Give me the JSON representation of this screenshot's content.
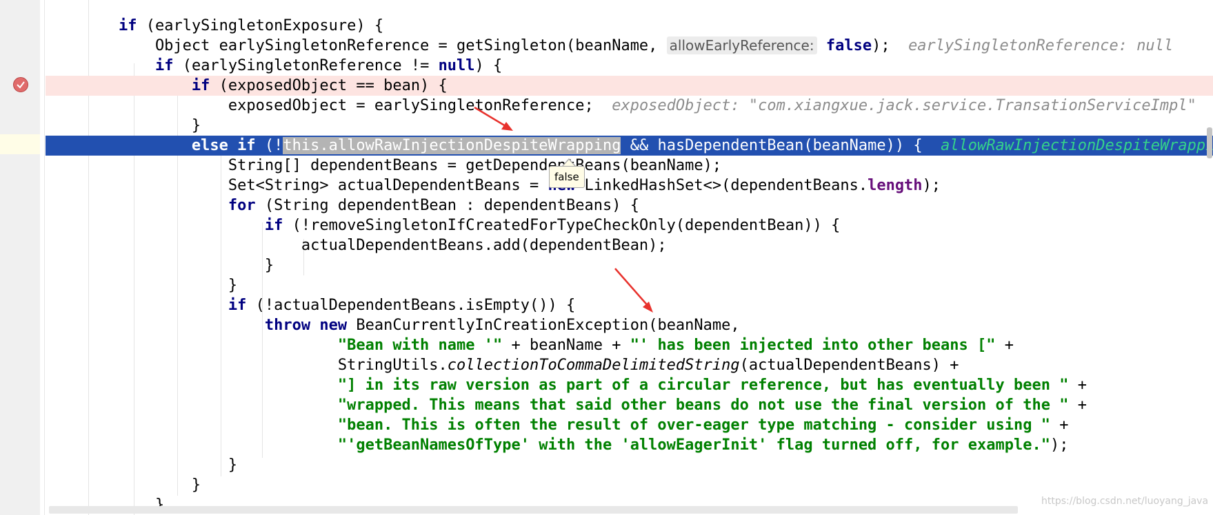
{
  "editor": {
    "lines": [
      [
        {
          "t": "        "
        },
        {
          "t": "if",
          "c": "kw"
        },
        {
          "t": " (earlySingletonExposure) {"
        }
      ],
      [
        {
          "t": "            Object earlySingletonReference = getSingleton(beanName, "
        },
        {
          "t": "allowEarlyReference:",
          "c": "param"
        },
        {
          "t": " "
        },
        {
          "t": "false",
          "c": "kw"
        },
        {
          "t": ");  "
        },
        {
          "t": "earlySingletonReference: null",
          "c": "cmt"
        }
      ],
      [
        {
          "t": "            "
        },
        {
          "t": "if",
          "c": "kw"
        },
        {
          "t": " (earlySingletonReference != "
        },
        {
          "t": "null",
          "c": "kw"
        },
        {
          "t": ") {"
        }
      ],
      [
        {
          "t": "                "
        },
        {
          "t": "if",
          "c": "kw"
        },
        {
          "t": " (exposedObject == bean) {"
        }
      ],
      [
        {
          "t": "                    exposedObject = earlySingletonReference;  "
        },
        {
          "t": "exposedObject: \"com.xiangxue.jack.service.TransationServiceImpl\"",
          "c": "cmt"
        }
      ],
      [
        {
          "t": "                }"
        }
      ],
      [
        {
          "t": "                "
        },
        {
          "t": "else if",
          "c": "kw"
        },
        {
          "t": " (!"
        },
        {
          "t": "this.allowRawInjectionDespiteWrapping",
          "c": "sel"
        },
        {
          "t": " && hasDependentBean(beanName)) {  "
        },
        {
          "t": "allowRawInjectionDespiteWrapping: false",
          "c": "hint"
        }
      ],
      [
        {
          "t": "                    String[] dependentBeans = getDependentBeans(beanName);"
        }
      ],
      [
        {
          "t": "                    Set<String> actualDependentBeans = "
        },
        {
          "t": "new",
          "c": "kw"
        },
        {
          "t": " LinkedHashSet<>(dependentBeans."
        },
        {
          "t": "length",
          "c": "fld"
        },
        {
          "t": ");"
        }
      ],
      [
        {
          "t": "                    "
        },
        {
          "t": "for",
          "c": "kw"
        },
        {
          "t": " (String dependentBean : dependentBeans) {"
        }
      ],
      [
        {
          "t": "                        "
        },
        {
          "t": "if",
          "c": "kw"
        },
        {
          "t": " (!removeSingletonIfCreatedForTypeCheckOnly(dependentBean)) {"
        }
      ],
      [
        {
          "t": "                            actualDependentBeans.add(dependentBean);"
        }
      ],
      [
        {
          "t": "                        }"
        }
      ],
      [
        {
          "t": "                    }"
        }
      ],
      [
        {
          "t": "                    "
        },
        {
          "t": "if",
          "c": "kw"
        },
        {
          "t": " (!actualDependentBeans.isEmpty()) {"
        }
      ],
      [
        {
          "t": "                        "
        },
        {
          "t": "throw new",
          "c": "kw"
        },
        {
          "t": " BeanCurrentlyInCreationException(beanName,"
        }
      ],
      [
        {
          "t": "                                "
        },
        {
          "t": "\"Bean with name '\"",
          "c": "str"
        },
        {
          "t": " + beanName + "
        },
        {
          "t": "\"' has been injected into other beans [\"",
          "c": "str"
        },
        {
          "t": " +"
        }
      ],
      [
        {
          "t": "                                StringUtils."
        },
        {
          "t": "collectionToCommaDelimitedString",
          "c": "it"
        },
        {
          "t": "(actualDependentBeans) +"
        }
      ],
      [
        {
          "t": "                                "
        },
        {
          "t": "\"] in its raw version as part of a circular reference, but has eventually been \"",
          "c": "str"
        },
        {
          "t": " +"
        }
      ],
      [
        {
          "t": "                                "
        },
        {
          "t": "\"wrapped. This means that said other beans do not use the final version of the \"",
          "c": "str"
        },
        {
          "t": " +"
        }
      ],
      [
        {
          "t": "                                "
        },
        {
          "t": "\"bean. This is often the result of over-eager type matching - consider using \"",
          "c": "str"
        },
        {
          "t": " +"
        }
      ],
      [
        {
          "t": "                                "
        },
        {
          "t": "\"'getBeanNamesOfType' with the 'allowEagerInit' flag turned off, for example.\"",
          "c": "str"
        },
        {
          "t": ");"
        }
      ],
      [
        {
          "t": "                    }"
        }
      ],
      [
        {
          "t": "                }"
        }
      ],
      [
        {
          "t": "            }"
        }
      ]
    ],
    "breakpoint_line": 3,
    "execution_line": 6
  },
  "tooltip": {
    "text": "false"
  },
  "watermark": "https://blog.csdn.net/luoyang_java",
  "colors": {
    "keyword": "#000080",
    "string": "#008000",
    "execution_line": "#2250b0",
    "breakpoint_line": "#fde4e1",
    "breakpoint_icon": "#e06b6b"
  },
  "icons": [
    "breakpoint-check-icon"
  ]
}
